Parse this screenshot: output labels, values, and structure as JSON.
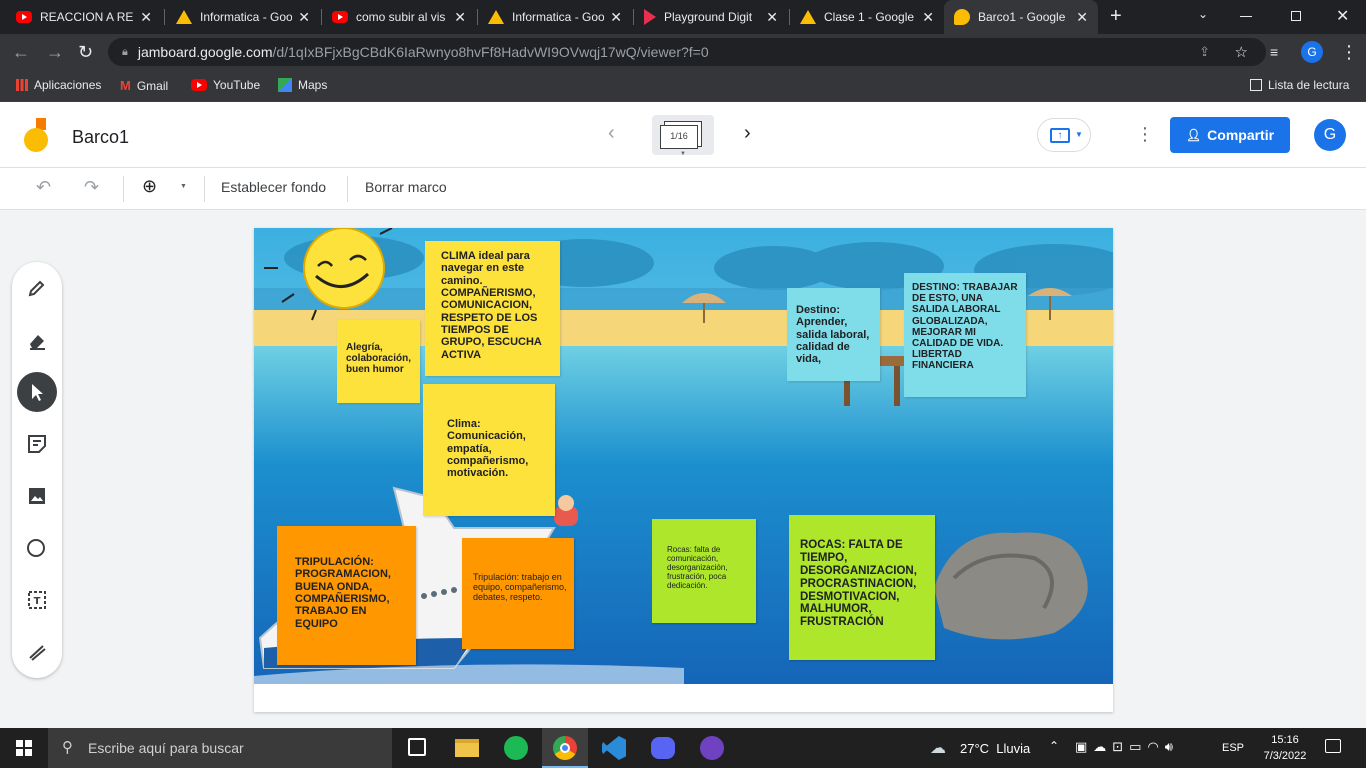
{
  "browser": {
    "tabs": [
      {
        "title": "REACCION A RES",
        "icon": "youtube-icon"
      },
      {
        "title": "Informatica - Goo",
        "icon": "drive-icon"
      },
      {
        "title": "como subir al vis",
        "icon": "youtube-icon"
      },
      {
        "title": "Informatica - Goo",
        "icon": "drive-icon"
      },
      {
        "title": "Playground Digit",
        "icon": "playground-icon"
      },
      {
        "title": "Clase 1 - Google",
        "icon": "drive-icon"
      },
      {
        "title": "Barco1 - Google",
        "icon": "jamboard-icon"
      }
    ],
    "url_host": "jamboard.google.com",
    "url_path": "/d/1qIxBFjxBgCBdK6IaRwnyo8hvFf8HadvWI9OVwqj17wQ/viewer?f=0",
    "profile_initial": "G",
    "bookmarks": [
      "Aplicaciones",
      "Gmail",
      "YouTube",
      "Maps"
    ],
    "reading_list": "Lista de lectura"
  },
  "app": {
    "title": "Barco1",
    "frame_counter": "1/16",
    "share_label": "Compartir",
    "avatar_initial": "G",
    "toolbar": {
      "set_background": "Establecer fondo",
      "clear_frame": "Borrar marco"
    }
  },
  "board": {
    "notes": {
      "n1": "Alegría, colaboración, buen humor",
      "n2": "CLIMA ideal para navegar en este camino. COMPAÑERISMO, COMUNICACION, RESPETO DE LOS TIEMPOS DE GRUPO, ESCUCHA ACTIVA",
      "n3": "Clima: Comunicación, empatía, compañerismo, motivación.",
      "n4": "Destino: Aprender, salida laboral, calidad de vida,",
      "n5": "DESTINO: TRABAJAR DE ESTO, UNA SALIDA LABORAL GLOBALIZADA, MEJORAR MI CALIDAD DE VIDA. LIBERTAD FINANCIERA",
      "n6": "TRIPULACIÓN: PROGRAMACION, BUENA ONDA, COMPAÑERISMO, TRABAJO EN EQUIPO",
      "n7": "Tripulación: trabajo en equipo, compañerismo, debates, respeto.",
      "n8": "Rocas: falta de comunicación, desorganización, frustración, poca dedicación.",
      "n9": "ROCAS: FALTA DE TIEMPO, DESORGANIZACION, PROCRASTINACION, DESMOTIVACION, MALHUMOR, FRUSTRACIÓN"
    },
    "colors": {
      "yellow": "#fde23c",
      "orange": "#ff9800",
      "cyan": "#7fdde9",
      "green": "#ade62b"
    }
  },
  "taskbar": {
    "search_placeholder": "Escribe aquí para buscar",
    "weather": "27°C  Lluvia",
    "language": "ESP",
    "time": "15:16",
    "date": "7/3/2022"
  }
}
